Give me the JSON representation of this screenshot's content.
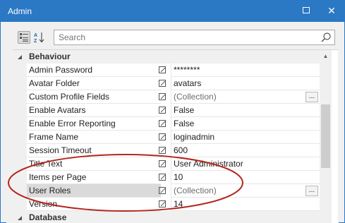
{
  "window": {
    "title": "Admin",
    "maximize_icon": "maximize-icon",
    "close_icon": "close-icon",
    "titlebar_color": "#2b78c5"
  },
  "toolbar": {
    "categorized_icon": "categorized-view-icon",
    "alphabetical_icon": "sort-alphabetical-icon",
    "search_placeholder": "Search",
    "search_icon": "search-icon"
  },
  "grid": {
    "categories": [
      {
        "label": "Behaviour",
        "expanded": true
      },
      {
        "label": "Database",
        "expanded": true
      }
    ],
    "rows": [
      {
        "name": "Admin Password",
        "value": "********",
        "dim": false,
        "has_ellipsis": false
      },
      {
        "name": "Avatar Folder",
        "value": "avatars",
        "dim": false,
        "has_ellipsis": false
      },
      {
        "name": "Custom Profile Fields",
        "value": "(Collection)",
        "dim": true,
        "has_ellipsis": true
      },
      {
        "name": "Enable Avatars",
        "value": "False",
        "dim": false,
        "has_ellipsis": false
      },
      {
        "name": "Enable Error Reporting",
        "value": "False",
        "dim": false,
        "has_ellipsis": false
      },
      {
        "name": "Frame Name",
        "value": "loginadmin",
        "dim": false,
        "has_ellipsis": false
      },
      {
        "name": "Session Timeout",
        "value": "600",
        "dim": false,
        "has_ellipsis": false
      },
      {
        "name": "Title Text",
        "value": "User Administrator",
        "dim": false,
        "has_ellipsis": false
      },
      {
        "name": "Items per Page",
        "value": "10",
        "dim": false,
        "has_ellipsis": false
      },
      {
        "name": "User Roles",
        "value": "(Collection)",
        "dim": true,
        "has_ellipsis": true,
        "selected": true
      },
      {
        "name": "Version",
        "value": "14",
        "dim": false,
        "has_ellipsis": false
      }
    ],
    "ellipsis_label": "...",
    "scroll_up_icon": "scroll-up-arrow-icon"
  },
  "annotation": {
    "color": "#b3261e",
    "highlights": "Items per Page, User Roles, Version"
  }
}
